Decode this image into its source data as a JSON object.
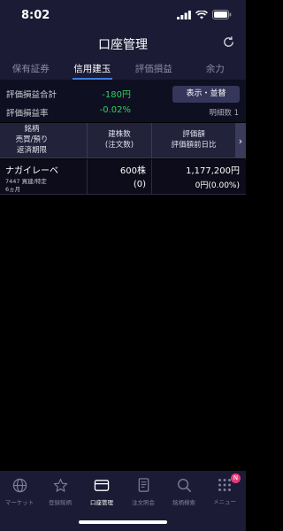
{
  "status": {
    "time": "8:02"
  },
  "nav": {
    "title": "口座管理"
  },
  "tabs": [
    {
      "label": "保有証券",
      "active": false
    },
    {
      "label": "信用建玉",
      "active": true
    },
    {
      "label": "評価損益",
      "active": false
    },
    {
      "label": "余力",
      "active": false
    }
  ],
  "summary": {
    "pl_total_label": "評価損益合計",
    "pl_total_value": "-180円",
    "pl_rate_label": "評価損益率",
    "pl_rate_value": "-0.02%",
    "display_sort_button": "表示・並替",
    "detail_count": "明細数 1"
  },
  "table_header": {
    "col1": [
      "銘柄",
      "売買/預り",
      "返済期限"
    ],
    "col2": [
      "建株数",
      "(注文数)"
    ],
    "col3": [
      "評価額",
      "評価額前日比"
    ],
    "arrow": "›"
  },
  "rows": [
    {
      "name": "ナガイレーベ",
      "code_type": "7447 買建/特定",
      "term": "6ヵ月",
      "quantity": "600株",
      "order_qty": "(0)",
      "valuation": "1,177,200円",
      "change": "0円(0.00%)"
    }
  ],
  "tabbar": [
    {
      "label": "マーケット",
      "icon": "globe-icon"
    },
    {
      "label": "登録銘柄",
      "icon": "star-icon"
    },
    {
      "label": "口座管理",
      "icon": "wallet-icon",
      "active": true
    },
    {
      "label": "注文照会",
      "icon": "document-icon"
    },
    {
      "label": "銘柄検索",
      "icon": "search-icon"
    },
    {
      "label": "メニュー",
      "icon": "grid-icon",
      "badge": "N"
    }
  ],
  "colors": {
    "positive_green": "#2ed15a",
    "accent_blue": "#3f7ddb",
    "navbar_bg": "#1b1b35",
    "badge_pink": "#e83a7a"
  }
}
